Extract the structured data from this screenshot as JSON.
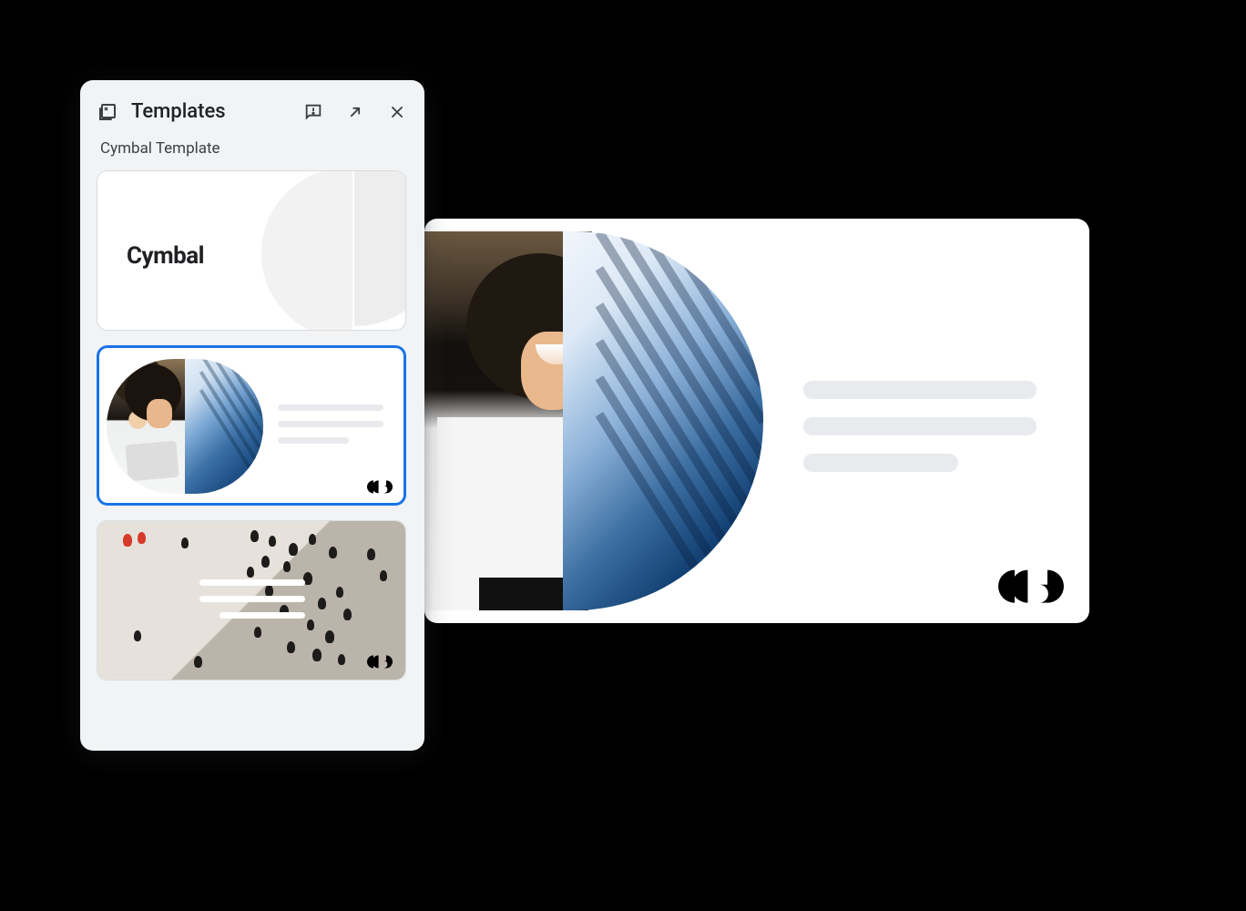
{
  "panel": {
    "title": "Templates",
    "subtitle": "Cymbal Template",
    "icons": {
      "templates": "templates-icon",
      "feedback": "feedback-icon",
      "expand": "expand-icon",
      "close": "close-icon"
    }
  },
  "templates": [
    {
      "id": "cymbal-title",
      "label": "Cymbal",
      "selected": false
    },
    {
      "id": "cymbal-photo-content",
      "label": "",
      "selected": true
    },
    {
      "id": "cymbal-crowd",
      "label": "",
      "selected": false
    }
  ],
  "preview": {
    "logo": "cymbal-logo"
  }
}
